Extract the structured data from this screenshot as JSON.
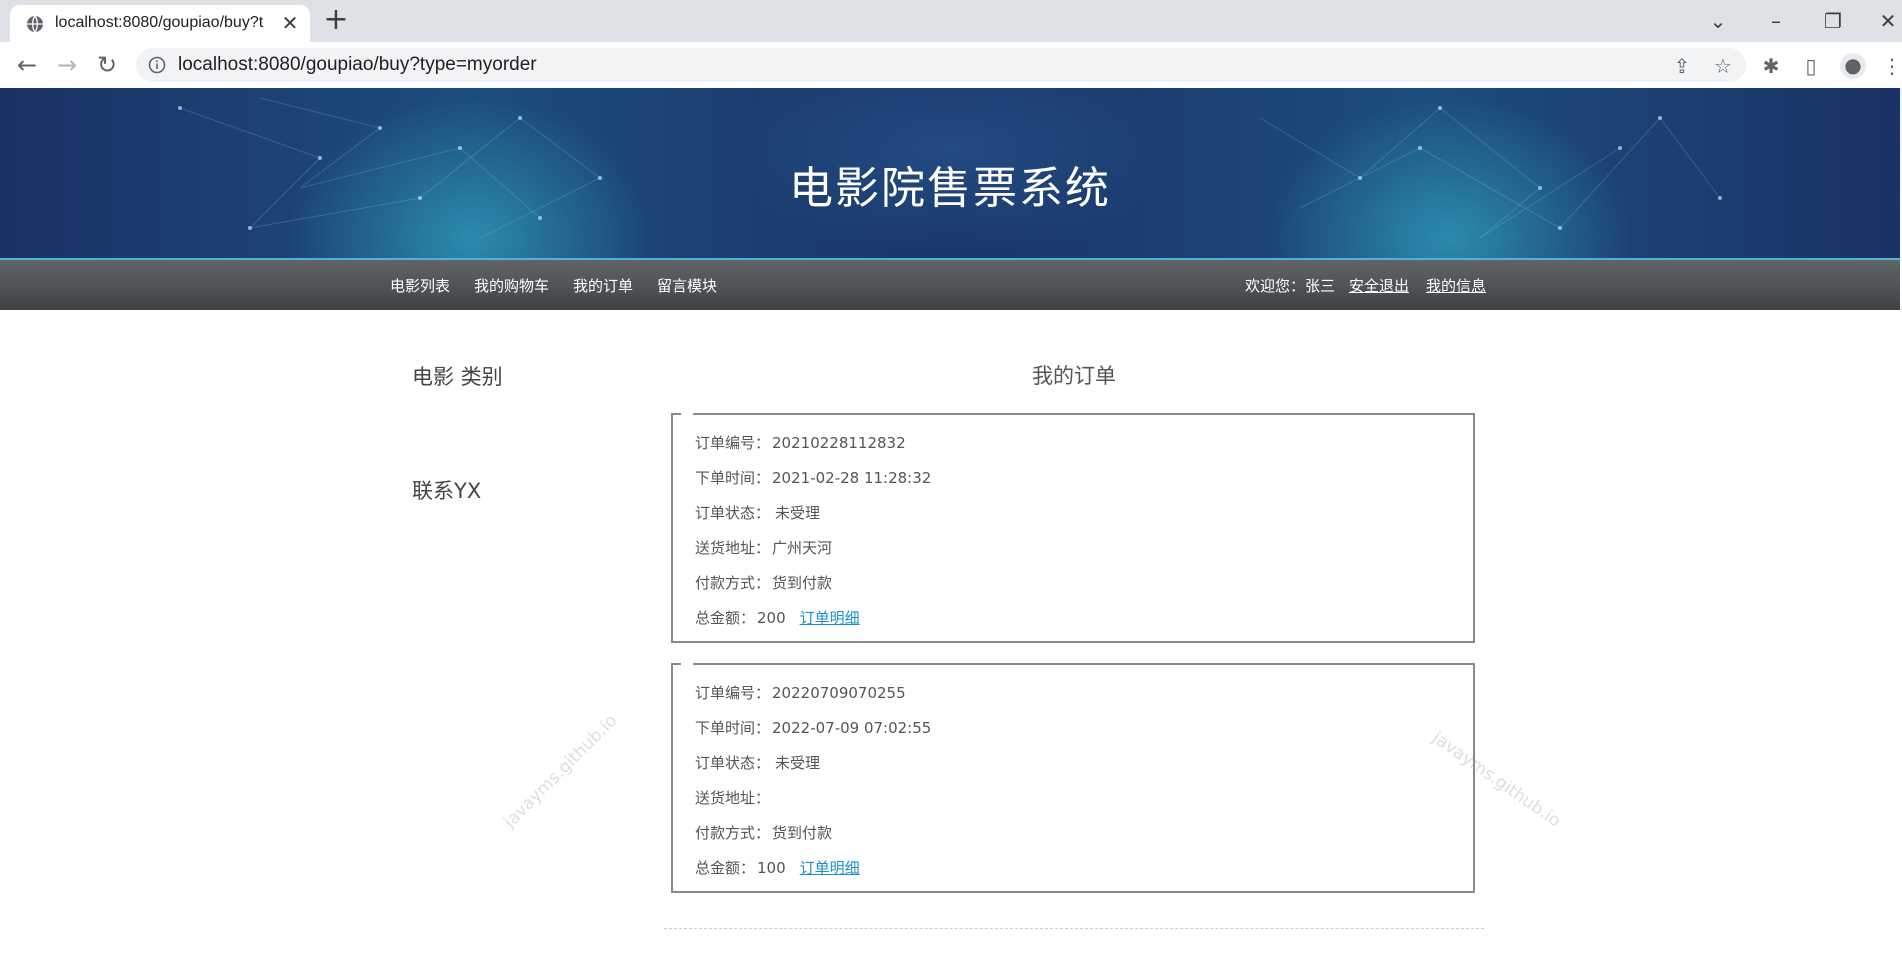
{
  "browser": {
    "tab_title": "localhost:8080/goupiao/buy?t",
    "url": "localhost:8080/goupiao/buy?type=myorder"
  },
  "site": {
    "title": "电影院售票系统"
  },
  "nav": {
    "items": [
      "电影列表",
      "我的购物车",
      "我的订单",
      "留言模块"
    ],
    "welcome": "欢迎您：张三",
    "logout": "安全退出",
    "my_info": "我的信息"
  },
  "sidebar": {
    "category_heading": "电影 类别",
    "contact_heading": "联系YX"
  },
  "orders": {
    "heading": "我的订单",
    "labels": {
      "order_no": "订单编号：",
      "order_time": "下单时间：",
      "status": "订单状态：",
      "address": "送货地址：",
      "payment": "付款方式：",
      "total": "总金额："
    },
    "detail_link": "订单明细",
    "list": [
      {
        "order_no": "20210228112832",
        "order_time": "2021-02-28 11:28:32",
        "status": "未受理",
        "address": "广州天河",
        "payment": "货到付款",
        "total": "200"
      },
      {
        "order_no": "20220709070255",
        "order_time": "2022-07-09 07:02:55",
        "status": "未受理",
        "address": "",
        "payment": "货到付款",
        "total": "100"
      }
    ]
  },
  "watermark": "javayms.github.io",
  "colors": {
    "nav_border": "#4fb3d9",
    "link": "#1a8fd0",
    "banner": "#1a3266"
  }
}
